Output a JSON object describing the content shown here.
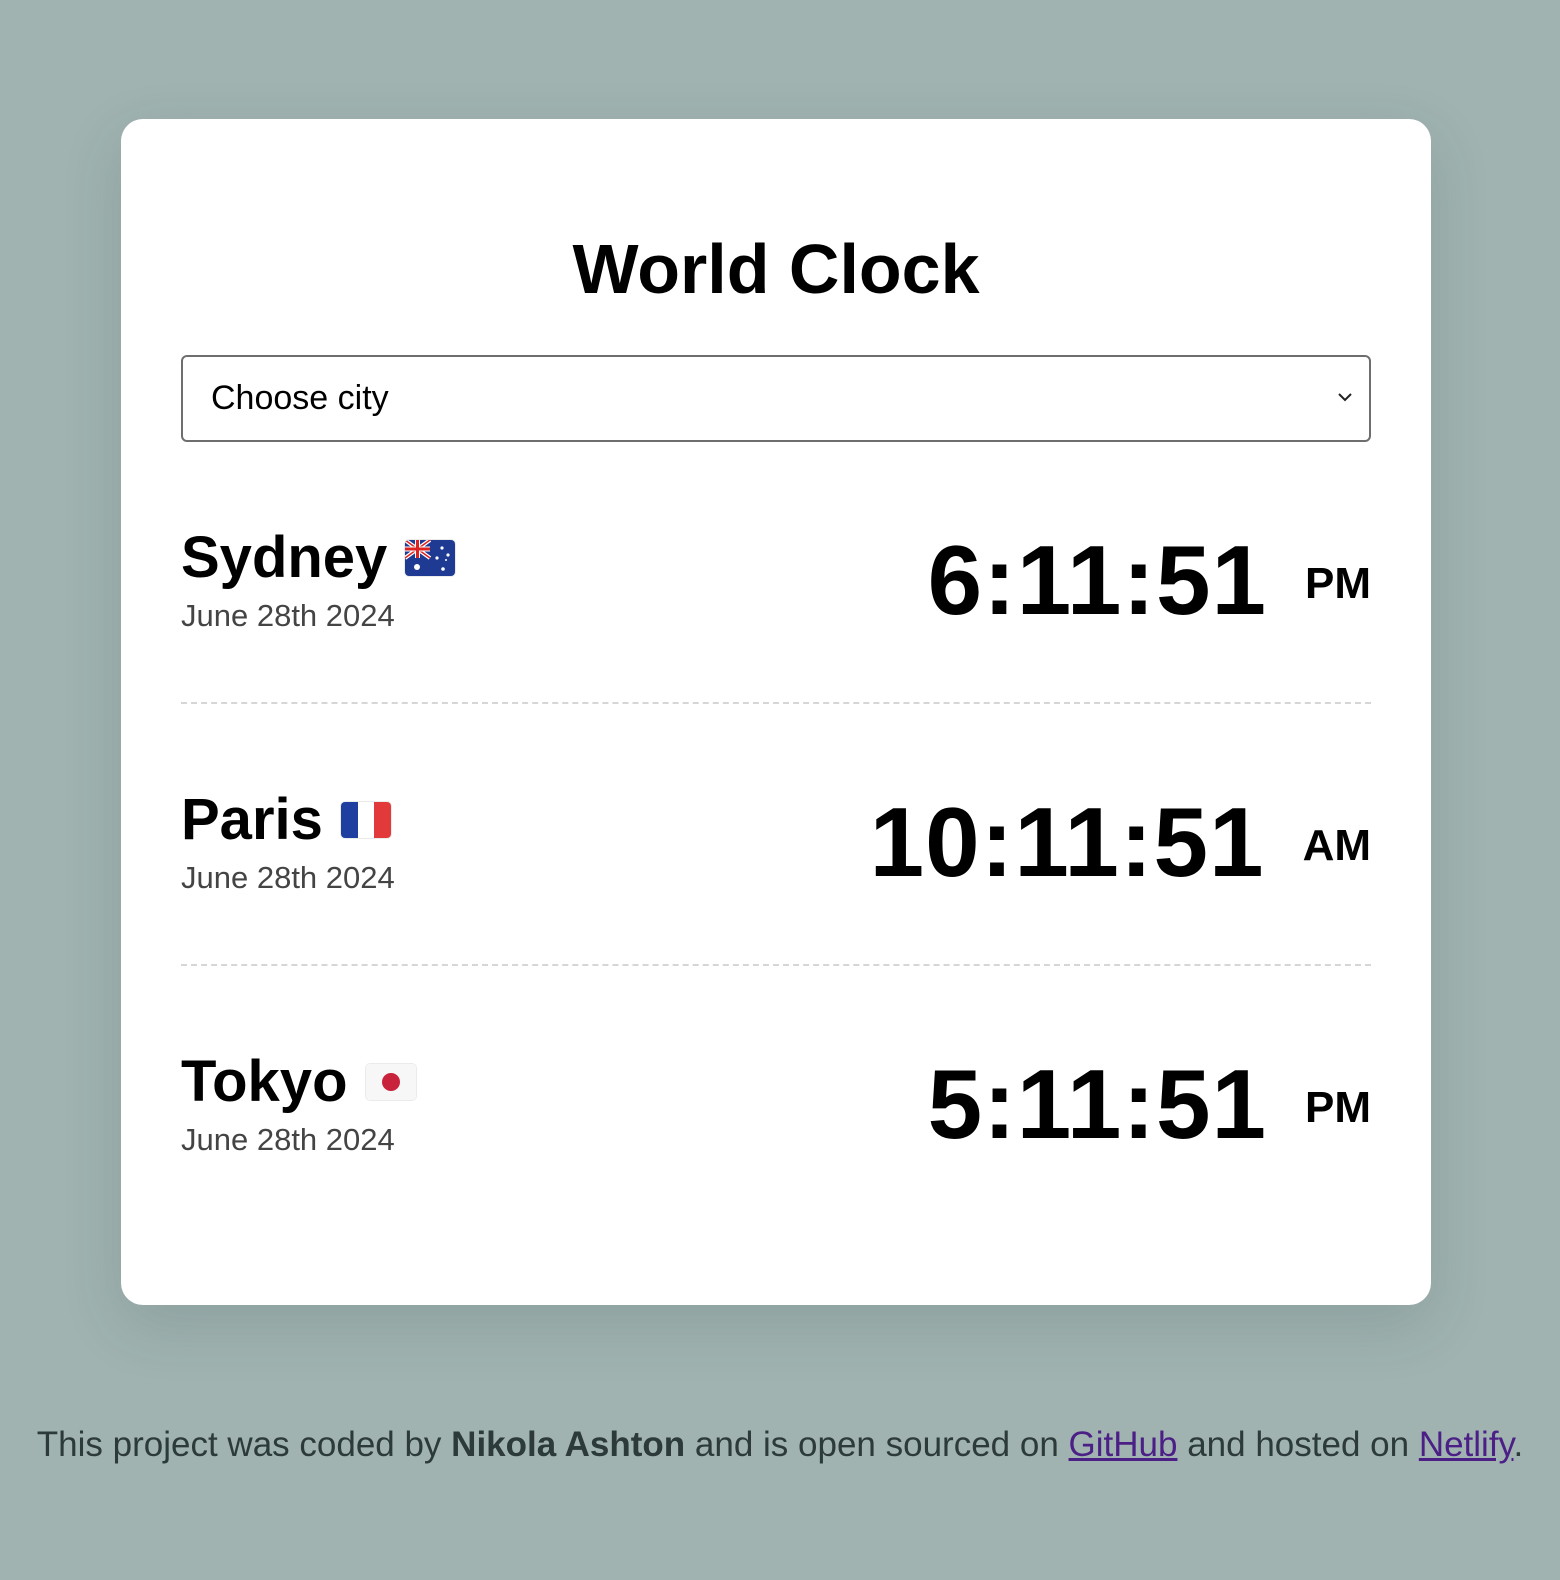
{
  "app": {
    "title": "World Clock"
  },
  "city_select": {
    "selected": "Choose city"
  },
  "cities": [
    {
      "name": "Sydney",
      "flag": "australia-flag-icon",
      "date": "June 28th 2024",
      "time": "6:11:51",
      "ampm": "PM"
    },
    {
      "name": "Paris",
      "flag": "france-flag-icon",
      "date": "June 28th 2024",
      "time": "10:11:51",
      "ampm": "AM"
    },
    {
      "name": "Tokyo",
      "flag": "japan-flag-icon",
      "date": "June 28th 2024",
      "time": "5:11:51",
      "ampm": "PM"
    }
  ],
  "footer": {
    "prefix": "This project was coded by",
    "author": "Nikola Ashton",
    "middle": "and is open sourced on",
    "github_label": "GitHub",
    "middle2": "and hosted on",
    "netlify_label": "Netlify",
    "suffix": "."
  },
  "colors": {
    "background": "#a0b3b1",
    "card": "#ffffff",
    "link": "#4b1f86"
  }
}
